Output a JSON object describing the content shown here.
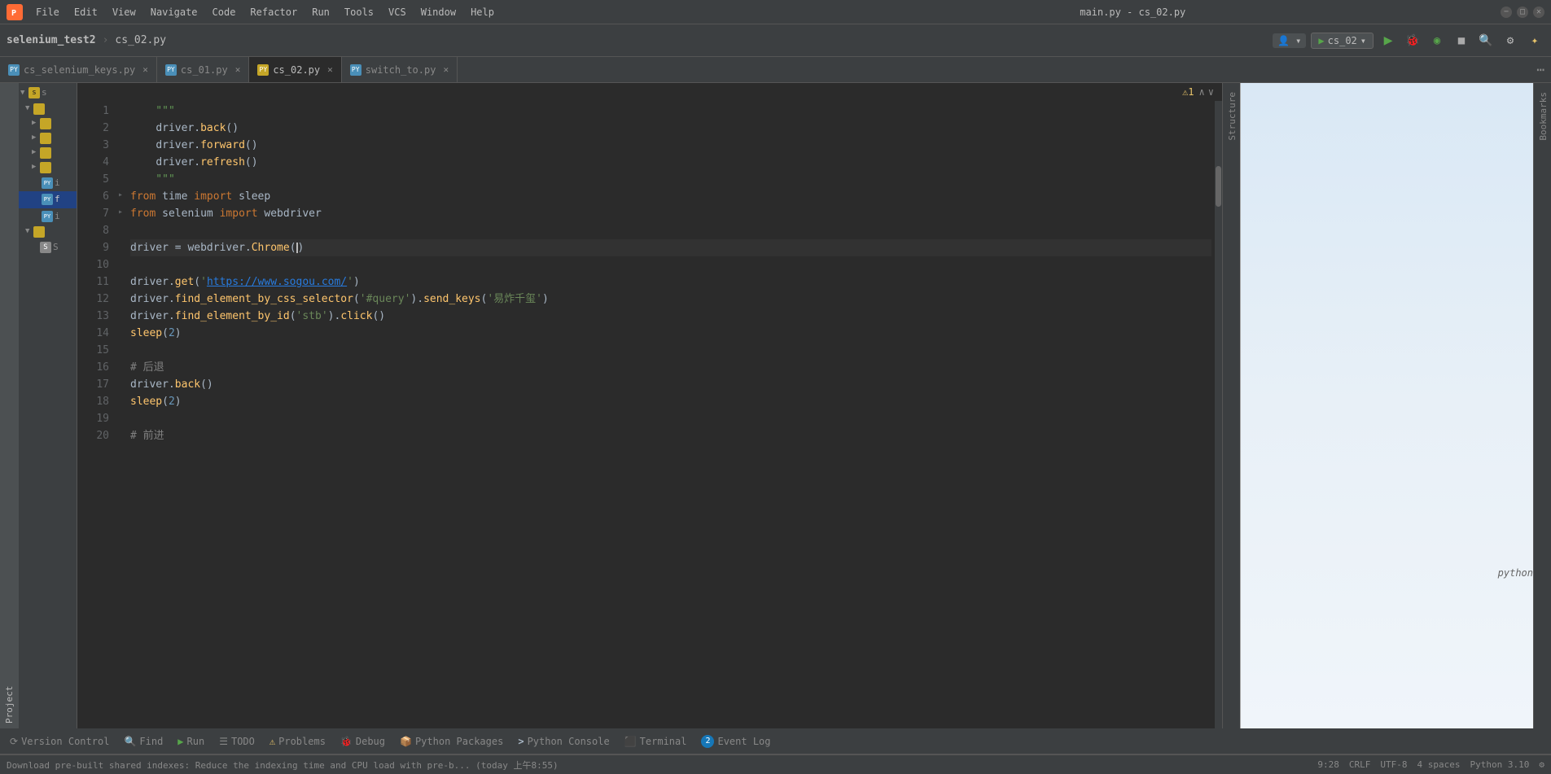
{
  "titlebar": {
    "app_icon": "PY",
    "menu_items": [
      "File",
      "Edit",
      "View",
      "Navigate",
      "Code",
      "Refactor",
      "Run",
      "Tools",
      "VCS",
      "Window",
      "Help"
    ],
    "title": "main.py - cs_02.py",
    "minimize_label": "−",
    "maximize_label": "□",
    "close_label": "✕"
  },
  "toolbar": {
    "project_name": "selenium_test2",
    "file_name": "cs_02.py",
    "run_config": "cs_02",
    "user_icon": "👤",
    "run_icon": "▶",
    "debug_icon": "🐞",
    "bookmark_icon": "🔖",
    "stop_icon": "■",
    "search_icon": "🔍",
    "settings_icon": "⚙",
    "extras_icon": "✦"
  },
  "tabs": [
    {
      "label": "cs_selenium_keys.py",
      "icon": "PY",
      "icon_color": "blue",
      "closeable": true
    },
    {
      "label": "cs_01.py",
      "icon": "PY",
      "icon_color": "blue",
      "closeable": true
    },
    {
      "label": "cs_02.py",
      "icon": "PY",
      "icon_color": "yellow",
      "closeable": true,
      "active": true
    },
    {
      "label": "switch_to.py",
      "icon": "PY",
      "icon_color": "blue",
      "closeable": true
    }
  ],
  "editor": {
    "warning_count": "1",
    "lines": [
      {
        "num": "1",
        "fold": false,
        "content": "    \"\"\"",
        "type": "docstring"
      },
      {
        "num": "2",
        "fold": false,
        "content": "    driver.back()",
        "type": "normal"
      },
      {
        "num": "3",
        "fold": false,
        "content": "    driver.forward()",
        "type": "normal"
      },
      {
        "num": "4",
        "fold": false,
        "content": "    driver.refresh()",
        "type": "normal"
      },
      {
        "num": "5",
        "fold": false,
        "content": "    \"\"\"",
        "type": "docstring"
      },
      {
        "num": "6",
        "fold": true,
        "content": "from time import sleep",
        "type": "import"
      },
      {
        "num": "7",
        "fold": true,
        "content": "from selenium import webdriver",
        "type": "import"
      },
      {
        "num": "8",
        "fold": false,
        "content": "",
        "type": "empty"
      },
      {
        "num": "9",
        "fold": false,
        "content": "driver = webdriver.Chrome()",
        "type": "assign",
        "highlighted": true
      },
      {
        "num": "10",
        "fold": false,
        "content": "",
        "type": "empty"
      },
      {
        "num": "11",
        "fold": false,
        "content": "driver.get('https://www.sogou.com/')",
        "type": "call"
      },
      {
        "num": "12",
        "fold": false,
        "content": "driver.find_element_by_css_selector('#query').send_keys('易炸千玺')",
        "type": "call"
      },
      {
        "num": "13",
        "fold": false,
        "content": "driver.find_element_by_id('stb').click()",
        "type": "call"
      },
      {
        "num": "14",
        "fold": false,
        "content": "sleep(2)",
        "type": "call"
      },
      {
        "num": "15",
        "fold": false,
        "content": "",
        "type": "empty"
      },
      {
        "num": "16",
        "fold": false,
        "content": "# 后退",
        "type": "comment"
      },
      {
        "num": "17",
        "fold": false,
        "content": "driver.back()",
        "type": "call"
      },
      {
        "num": "18",
        "fold": false,
        "content": "sleep(2)",
        "type": "call"
      },
      {
        "num": "19",
        "fold": false,
        "content": "",
        "type": "empty"
      },
      {
        "num": "20",
        "fold": false,
        "content": "# 前进",
        "type": "comment"
      }
    ]
  },
  "sidebar": {
    "project_tab_label": "Project"
  },
  "structure_panel": {
    "label": "Structure"
  },
  "bookmarks_panel": {
    "label": "Bookmarks"
  },
  "tree": {
    "items": [
      {
        "indent": 0,
        "arrow": "▼",
        "icon": "folder",
        "label": "s",
        "selected": false
      },
      {
        "indent": 1,
        "arrow": "▼",
        "icon": "folder",
        "label": "",
        "selected": false
      },
      {
        "indent": 2,
        "arrow": "▶",
        "icon": "folder",
        "label": "",
        "selected": false
      },
      {
        "indent": 2,
        "arrow": "▶",
        "icon": "folder",
        "label": "",
        "selected": false
      },
      {
        "indent": 2,
        "arrow": "▶",
        "icon": "folder",
        "label": "",
        "selected": false
      },
      {
        "indent": 2,
        "arrow": "▶",
        "icon": "folder",
        "label": "",
        "selected": false
      },
      {
        "indent": 2,
        "arrow": "",
        "icon": "pyfile",
        "label": "i",
        "selected": false
      },
      {
        "indent": 2,
        "arrow": "",
        "icon": "pyfile",
        "label": "f",
        "selected": true
      },
      {
        "indent": 2,
        "arrow": "",
        "icon": "pyfile",
        "label": "i",
        "selected": false
      },
      {
        "indent": 1,
        "arrow": "▼",
        "icon": "folder",
        "label": "",
        "selected": false
      },
      {
        "indent": 2,
        "arrow": "",
        "icon": "other",
        "label": "S",
        "selected": false
      }
    ]
  },
  "bottom_tabs": [
    {
      "label": "Version Control",
      "icon": "⟳"
    },
    {
      "label": "Find",
      "icon": "🔍"
    },
    {
      "label": "Run",
      "icon": "▶"
    },
    {
      "label": "TODO",
      "icon": "☰"
    },
    {
      "label": "Problems",
      "icon": "⚠"
    },
    {
      "label": "Debug",
      "icon": "🐞"
    },
    {
      "label": "Python Packages",
      "icon": "📦"
    },
    {
      "label": "Python Console",
      "icon": ">"
    },
    {
      "label": "Terminal",
      "icon": "⬛"
    },
    {
      "label": "Event Log",
      "icon": "📋",
      "badge": "2"
    }
  ],
  "status_bar": {
    "message": "Download pre-built shared indexes: Reduce the indexing time and CPU load with pre-b... (today 上午8:55)",
    "position": "9:28",
    "line_ending": "CRLF",
    "encoding": "UTF-8",
    "indent": "4 spaces",
    "python_version": "Python 3.10",
    "settings_icon": "⚙"
  },
  "right_panel": {
    "python_label": "python"
  }
}
